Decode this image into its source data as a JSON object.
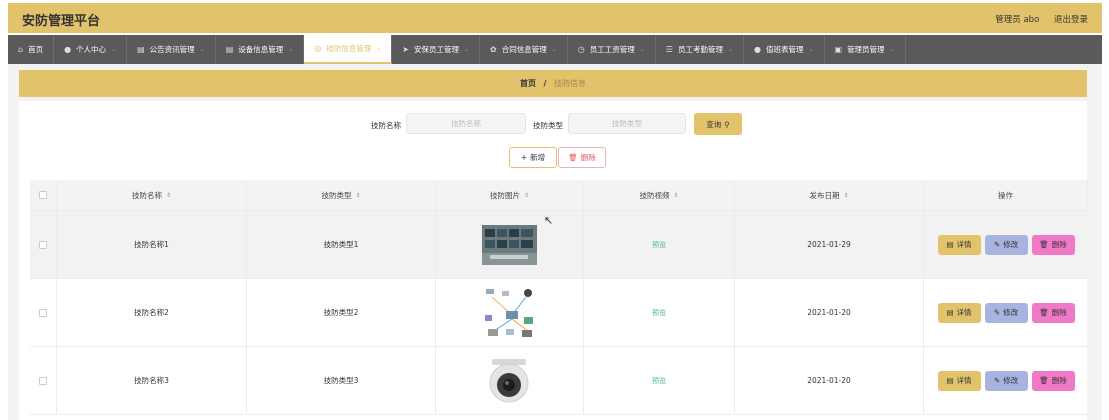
{
  "app": {
    "title": "安防管理平台",
    "admin_label": "管理员 abo",
    "logout_label": "退出登录"
  },
  "nav": [
    {
      "label": "首页",
      "icon": "home-icon",
      "glyph": "⌂",
      "arrow": false
    },
    {
      "label": "个人中心",
      "icon": "user-icon",
      "glyph": "●",
      "arrow": true
    },
    {
      "label": "公告资讯管理",
      "icon": "list-icon",
      "glyph": "▤",
      "arrow": true
    },
    {
      "label": "设备信息管理",
      "icon": "device-icon",
      "glyph": "▤",
      "arrow": true
    },
    {
      "label": "技防信息管理",
      "icon": "globe-icon",
      "glyph": "◎",
      "arrow": true,
      "active": true
    },
    {
      "label": "安保员工管理",
      "icon": "send-icon",
      "glyph": "➤",
      "arrow": true
    },
    {
      "label": "合同信息管理",
      "icon": "contract-icon",
      "glyph": "✿",
      "arrow": true
    },
    {
      "label": "员工工资管理",
      "icon": "wage-icon",
      "glyph": "◷",
      "arrow": true
    },
    {
      "label": "员工考勤管理",
      "icon": "attendance-icon",
      "glyph": "☰",
      "arrow": true
    },
    {
      "label": "值班表管理",
      "icon": "duty-icon",
      "glyph": "●",
      "arrow": true
    },
    {
      "label": "管理员管理",
      "icon": "admin-icon",
      "glyph": "▣",
      "arrow": true
    }
  ],
  "breadcrumb": {
    "home": "首页",
    "separator": "/",
    "current": "技防信息"
  },
  "search": {
    "name_label": "技防名称",
    "name_placeholder": "技防名称",
    "type_label": "技防类型",
    "type_placeholder": "技防类型",
    "query_label": "查询"
  },
  "actions": {
    "add_label": "新增",
    "delete_label": "删除"
  },
  "table": {
    "columns": [
      "技防名称",
      "技防类型",
      "技防图片",
      "技防视频",
      "发布日期",
      "操作"
    ],
    "rows": [
      {
        "name": "技防名称1",
        "type": "技防类型1",
        "image": "monitors-wall",
        "video": "预览",
        "date": "2021-01-29"
      },
      {
        "name": "技防名称2",
        "type": "技防类型2",
        "image": "system-diagram",
        "video": "预览",
        "date": "2021-01-20"
      },
      {
        "name": "技防名称3",
        "type": "技防类型3",
        "image": "dome-camera",
        "video": "预览",
        "date": "2021-01-20"
      }
    ],
    "op_labels": {
      "detail": "详情",
      "edit": "修改",
      "delete": "删除"
    }
  },
  "colors": {
    "accent": "#e2c36b",
    "nav_bg": "#5a5a5a",
    "edit": "#a8b3e0",
    "danger": "#f07ac8",
    "preview": "#47b88e"
  }
}
